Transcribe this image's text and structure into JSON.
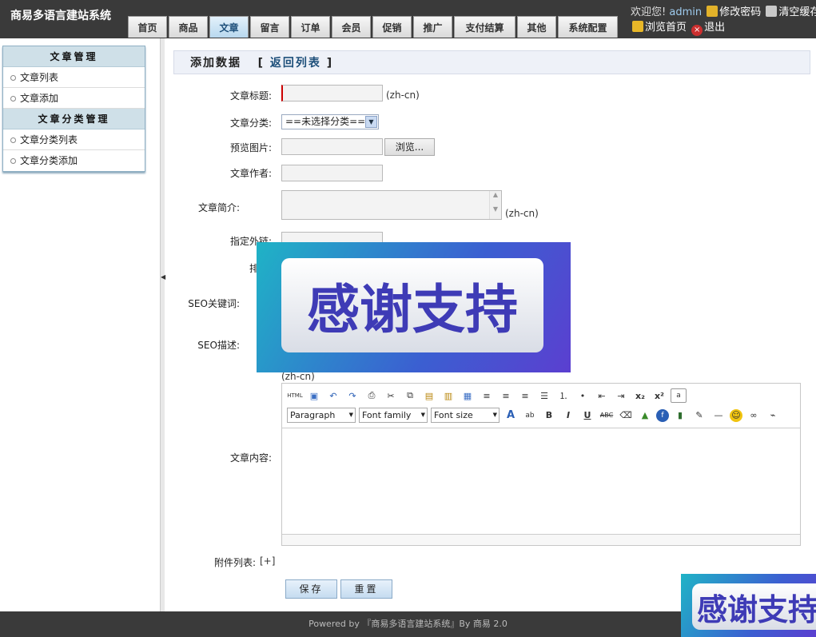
{
  "brand": "商易多语言建站系统",
  "nav": [
    "首页",
    "商品",
    "文章",
    "留言",
    "订单",
    "会员",
    "促销",
    "推广",
    "支付结算",
    "其他",
    "系统配置"
  ],
  "header": {
    "welcome": "欢迎您!",
    "user": "admin",
    "change_password": "修改密码",
    "clear_cache": "清空缓存",
    "browse_home": "浏览首页",
    "logout": "退出"
  },
  "sidebar": {
    "group1_title": "文章管理",
    "group1_items": [
      "文章列表",
      "文章添加"
    ],
    "group2_title": "文章分类管理",
    "group2_items": [
      "文章分类列表",
      "文章分类添加"
    ]
  },
  "page": {
    "title": "添加数据",
    "back_link": "返回列表",
    "bracket_open": "[",
    "bracket_close": "]"
  },
  "form": {
    "title_label": "文章标题:",
    "lang_hint": "(zh-cn)",
    "category_label": "文章分类:",
    "category_selected": "==未选择分类==",
    "image_label": "预览图片:",
    "browse_button": "浏览...",
    "author_label": "文章作者:",
    "summary_label": "文章简介:",
    "link_label": "指定外链:",
    "order_label": "排序:",
    "seo_keywords_label": "SEO关键词:",
    "seo_desc_label": "SEO描述:",
    "content_label": "文章内容:",
    "attachments_label": "附件列表:",
    "attachments_add": "[+]",
    "save_button": "保存",
    "reset_button": "重置"
  },
  "editor": {
    "format_select": "Paragraph",
    "font_family_select": "Font family",
    "font_size_select": "Font size"
  },
  "banner_text": "感谢支持",
  "footer": "Powered by 『商易多语言建站系统』By 商易 2.0"
}
